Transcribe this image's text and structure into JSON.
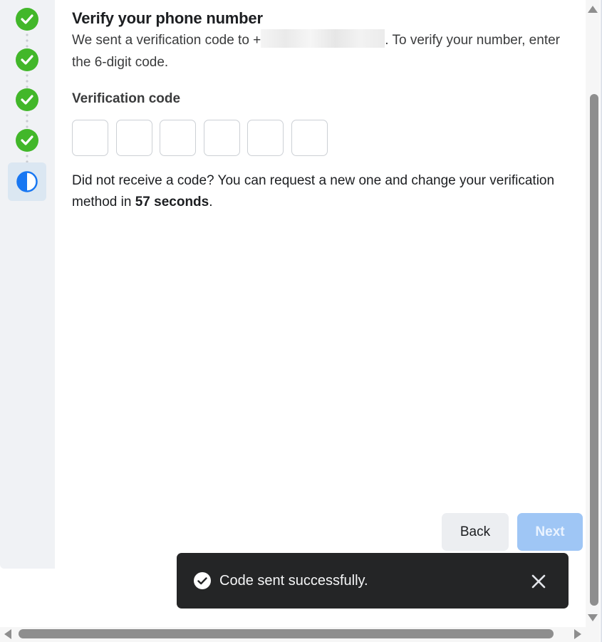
{
  "stepper": {
    "steps": [
      {
        "state": "complete",
        "icon": "check-circle-icon"
      },
      {
        "state": "complete",
        "icon": "check-circle-icon"
      },
      {
        "state": "complete",
        "icon": "check-circle-icon"
      },
      {
        "state": "complete",
        "icon": "check-circle-icon"
      },
      {
        "state": "in-progress",
        "icon": "half-circle-icon"
      }
    ],
    "complete_color": "#42b72a",
    "active_color": "#1877f2"
  },
  "verify": {
    "title": "Verify your phone number",
    "desc_prefix": "We sent a verification code to +",
    "desc_suffix": ". To verify your number, enter the 6-digit code.",
    "code_label": "Verification code",
    "code_length": 6,
    "code_values": [
      "",
      "",
      "",
      "",
      "",
      ""
    ],
    "resend_prefix": "Did not receive a code? You can request a new one and change your verification method in ",
    "resend_time": "57 seconds",
    "resend_suffix": "."
  },
  "buttons": {
    "back": "Back",
    "next": "Next",
    "next_disabled": true
  },
  "toast": {
    "message": "Code sent successfully.",
    "icon": "check-circle-icon",
    "close_icon": "close-icon"
  }
}
